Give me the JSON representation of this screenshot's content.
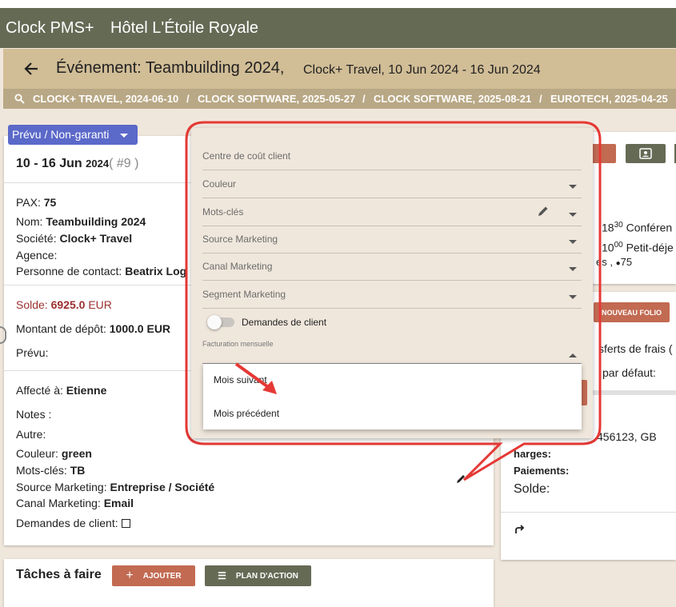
{
  "app": {
    "name": "Clock PMS+",
    "hotel": "Hôtel L'Étoile Royale"
  },
  "header": {
    "title": "Événement: Teambuilding 2024,",
    "subtitle": "Clock+ Travel, 10 Jun 2024 - 16 Jun 2024"
  },
  "breadcrumbs": [
    "CLOCK+ TRAVEL, 2024-06-10",
    "CLOCK SOFTWARE, 2025-05-27",
    "CLOCK SOFTWARE, 2025-08-21",
    "EUROTECH, 2025-04-25"
  ],
  "breadcrumb_sep": "/",
  "status_dropdown": "Prévu / Non-garanti",
  "event": {
    "dates": "10 - 16 Jun",
    "year": "2024",
    "number": "( #9 )",
    "pax_label": "PAX:",
    "pax": "75",
    "nom_label": "Nom:",
    "nom": "Teambuilding 2024",
    "societe_label": "Société:",
    "societe": "Clock+ Travel",
    "agence_label": "Agence:",
    "contact_label": "Personne de contact:",
    "contact": "Beatrix Log",
    "solde_label": "Solde:",
    "solde": "6925.0",
    "currency": "EUR",
    "depot_label": "Montant de dépôt:",
    "depot": "1000.0 EUR",
    "prevu_label": "Prévu:",
    "affecte_label": "Affecté à:",
    "affecte": "Etienne",
    "notes_label": "Notes :",
    "autre_label": "Autre:",
    "couleur_label": "Couleur:",
    "couleur": "green",
    "motscles_label": "Mots-clés:",
    "motscles": "TB",
    "source_label": "Source Marketing:",
    "source": "Entreprise / Société",
    "canal_label": "Canal Marketing:",
    "canal": "Email",
    "demandes_label": "Demandes de client:"
  },
  "right_panel": {
    "agenda1_time": "18",
    "agenda1_sup": "30",
    "agenda1_text": "Conféren",
    "agenda2_time": "10",
    "agenda2_sup": "00",
    "agenda2_text": "Petit-déje",
    "agenda3_text": "es ,",
    "agenda3_pax": "75",
    "folio_button": "NOUVEAU FOLIO",
    "transferts": "sferts de frais (",
    "defaut": "par défaut:",
    "account": "456123, GB",
    "charges": "harges:",
    "paiements": "Paiements:",
    "solde": "Solde:"
  },
  "tasks": {
    "title": "Tâches à faire",
    "add_label": "AJOUTER",
    "plan_label": "PLAN D'ACTION"
  },
  "form": {
    "centre_cout": "Centre de coût client",
    "couleur": "Couleur",
    "mots_cles": "Mots-clés",
    "source_marketing": "Source Marketing",
    "canal_marketing": "Canal Marketing",
    "segment_marketing": "Segment Marketing",
    "demandes_toggle": "Demandes de client",
    "facturation_label": "Facturation mensuelle",
    "facturation_options": [
      "Mois suivant",
      "Mois précédent"
    ]
  },
  "colors": {
    "topbar": "#656a55",
    "titlebar": "#d1bd96",
    "accent_button": "#c26a52",
    "dark_button": "#656a55",
    "status": "#5b69c9",
    "highlight": "#e53935"
  }
}
